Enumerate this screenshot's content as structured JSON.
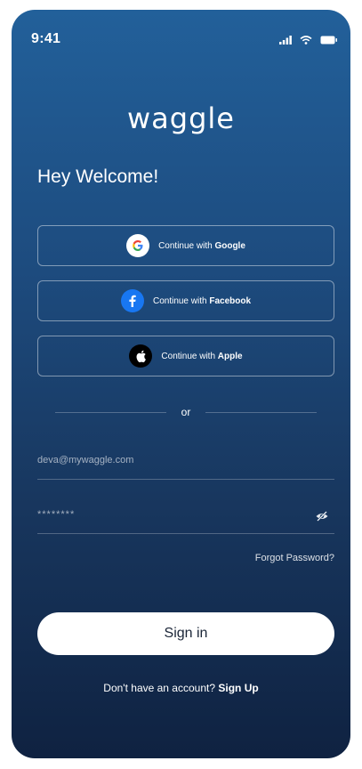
{
  "status_bar": {
    "time": "9:41",
    "icons": [
      "cellular-signal-icon",
      "wifi-icon",
      "battery-icon"
    ]
  },
  "app": {
    "logo_text": "waggle"
  },
  "login": {
    "title": "Hey Welcome!",
    "social_buttons": [
      {
        "prefix": "Continue with ",
        "provider": "Google",
        "icon": "google-icon"
      },
      {
        "prefix": "Continue with ",
        "provider": "Facebook",
        "icon": "facebook-icon"
      },
      {
        "prefix": "Continue with ",
        "provider": "Apple",
        "icon": "apple-icon"
      }
    ],
    "divider_text": "or",
    "email_value": "deva@mywaggle.com",
    "password_value": "********",
    "password_toggle_icon": "eye-off-icon",
    "forgot_password": "Forgot Password?",
    "sign_in_label": "Sign in",
    "no_account_text": "Don't have an account?",
    "sign_up_label": "Sign Up"
  },
  "colors": {
    "bg_top": "#22609a",
    "bg_bottom": "#0f2241",
    "button_bg": "#ffffff",
    "button_text": "#1a2537",
    "google_red": "#ea4335",
    "facebook_blue": "#1877f2"
  }
}
